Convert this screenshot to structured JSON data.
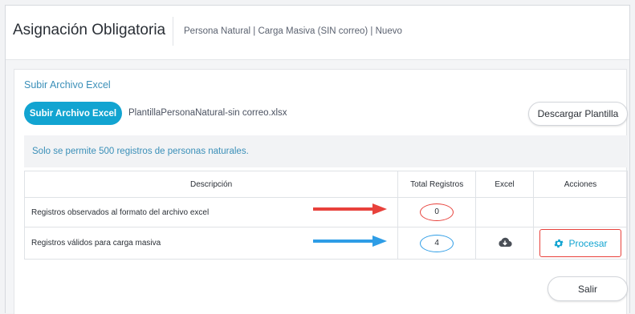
{
  "header": {
    "title": "Asignación Obligatoria",
    "breadcrumb": "Persona Natural | Carga Masiva (SIN correo) | Nuevo"
  },
  "upload": {
    "section_title": "Subir Archivo Excel",
    "button_label": "Subir Archivo Excel",
    "file_name": "PlantillaPersonaNatural-sin correo.xlsx",
    "download_label": "Descargar Plantilla"
  },
  "notice": "Solo se permite 500 registros de personas naturales.",
  "table": {
    "columns": [
      "Descripción",
      "Total Registros",
      "Excel",
      "Acciones"
    ],
    "rows": [
      {
        "description": "Registros observados al formato del archivo excel",
        "total": "0"
      },
      {
        "description": "Registros válidos para carga masiva",
        "total": "4",
        "excel_icon": "cloud-download-icon",
        "action_label": "Procesar",
        "action_icon": "gear-icon"
      }
    ]
  },
  "footer": {
    "exit_label": "Salir"
  },
  "colors": {
    "accent": "#12a4d1",
    "annotation_red": "#e8413b",
    "annotation_blue": "#2e9de6"
  }
}
